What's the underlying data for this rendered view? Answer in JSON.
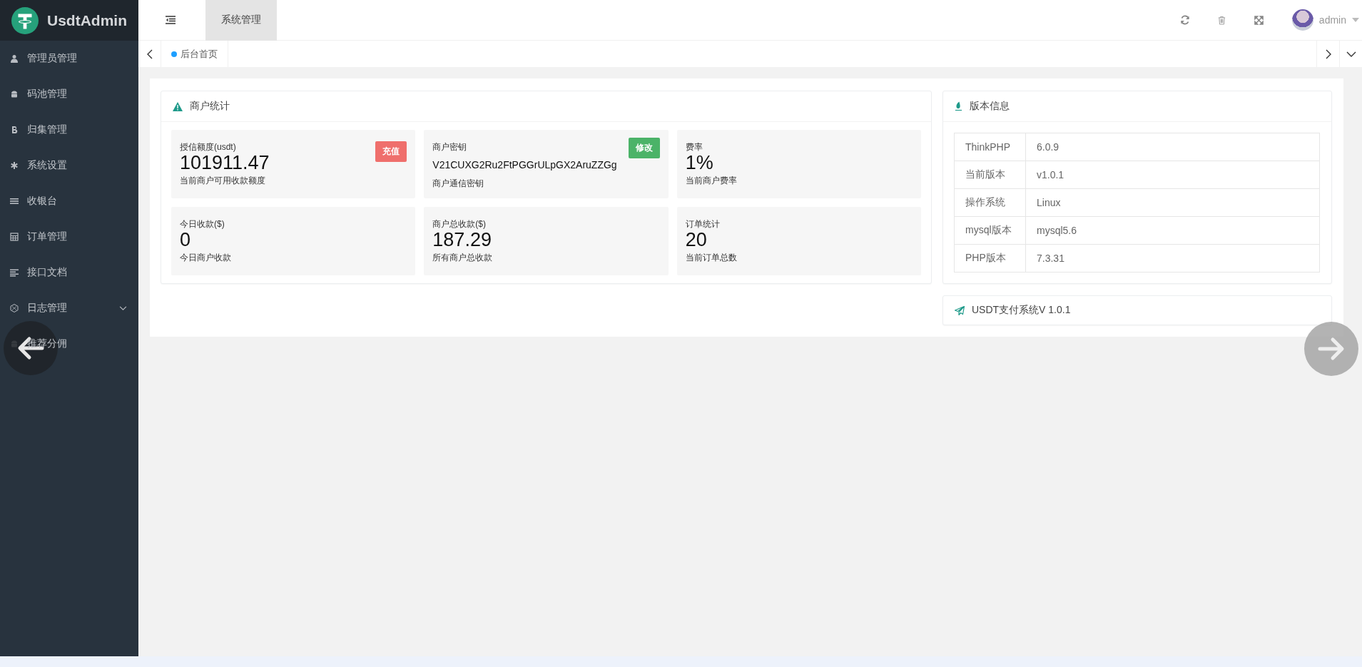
{
  "brand": {
    "name": "UsdtAdmin"
  },
  "sidebar": {
    "items": [
      {
        "label": "管理员管理",
        "kind": "link"
      },
      {
        "label": "码池管理",
        "kind": "link"
      },
      {
        "label": "归集管理",
        "kind": "link"
      },
      {
        "label": "系统设置",
        "kind": "link"
      },
      {
        "label": "收银台",
        "kind": "link"
      },
      {
        "label": "订单管理",
        "kind": "link"
      },
      {
        "label": "接口文档",
        "kind": "link"
      },
      {
        "label": "日志管理",
        "kind": "group"
      },
      {
        "label": "推荐分佣",
        "kind": "link"
      }
    ]
  },
  "header": {
    "menus": [
      {
        "label": "系统管理",
        "selected": true
      }
    ],
    "user": "admin"
  },
  "tabs": [
    {
      "label": "后台首页",
      "selected": true
    }
  ],
  "merchant_stats": {
    "title": "商户统计",
    "tiles": [
      {
        "label": "授信额度(usdt)",
        "value": "101911.47",
        "note": "当前商户可用收款额度",
        "action": {
          "label": "充值",
          "kind": "danger"
        },
        "kind": "number"
      },
      {
        "label": "商户密钥",
        "value": "V21CUXG2Ru2FtPGGrULpGX2AruZZGg",
        "note": "商户通信密钥",
        "action": {
          "label": "修改",
          "kind": "success"
        },
        "kind": "text"
      },
      {
        "label": "费率",
        "value": "1%",
        "note": "当前商户费率",
        "kind": "number"
      },
      {
        "label": "今日收款($)",
        "value": "0",
        "note": "今日商户收款",
        "kind": "number"
      },
      {
        "label": "商户总收款($)",
        "value": "187.29",
        "note": "所有商户总收款",
        "kind": "number"
      },
      {
        "label": "订单统计",
        "value": "20",
        "note": "当前订单总数",
        "kind": "number"
      }
    ]
  },
  "version_info": {
    "title": "版本信息",
    "rows": [
      {
        "name": "ThinkPHP",
        "value": "6.0.9"
      },
      {
        "name": "当前版本",
        "value": "v1.0.1"
      },
      {
        "name": "操作系统",
        "value": "Linux"
      },
      {
        "name": "mysql版本",
        "value": "mysql5.6"
      },
      {
        "name": "PHP版本",
        "value": "7.3.31"
      }
    ]
  },
  "footer_card": {
    "title": "USDT支付系统V 1.0.1"
  }
}
